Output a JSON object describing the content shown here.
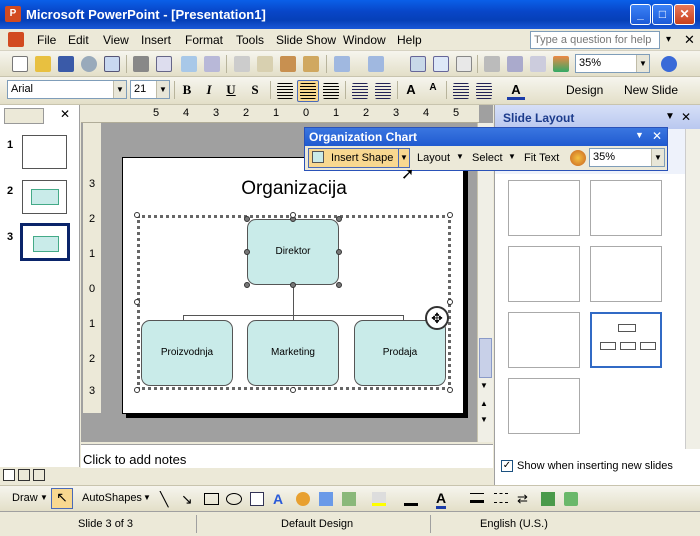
{
  "window": {
    "title": "Microsoft PowerPoint - [Presentation1]"
  },
  "menu": {
    "items": [
      "File",
      "Edit",
      "View",
      "Insert",
      "Format",
      "Tools",
      "Slide Show",
      "Window",
      "Help"
    ],
    "help_placeholder": "Type a question for help"
  },
  "toolbar": {
    "zoom": "35%",
    "font": "Arial",
    "size": "21",
    "design_label": "Design",
    "new_slide_label": "New Slide"
  },
  "thumbnails": [
    "1",
    "2",
    "3"
  ],
  "ruler": {
    "top": [
      "5",
      "4",
      "3",
      "2",
      "1",
      "0",
      "1",
      "2",
      "3",
      "4",
      "5"
    ],
    "left": [
      "3",
      "2",
      "1",
      "0",
      "1",
      "2",
      "3"
    ]
  },
  "slide": {
    "title": "Organizacija",
    "top_box": "Direktor",
    "boxes": [
      "Proizvodnja",
      "Marketing",
      "Prodaja"
    ]
  },
  "notes": "Click to add notes",
  "orgchart": {
    "title": "Organization Chart",
    "insert_shape": "Insert Shape",
    "layout": "Layout",
    "select": "Select",
    "fit_text": "Fit Text",
    "zoom": "35%"
  },
  "taskpane": {
    "title": "Slide Layout",
    "show_label": "Show when inserting new slides"
  },
  "drawbar": {
    "draw": "Draw",
    "autoshapes": "AutoShapes"
  },
  "status": {
    "slide": "Slide 3 of 3",
    "design": "Default Design",
    "language": "English (U.S.)"
  }
}
